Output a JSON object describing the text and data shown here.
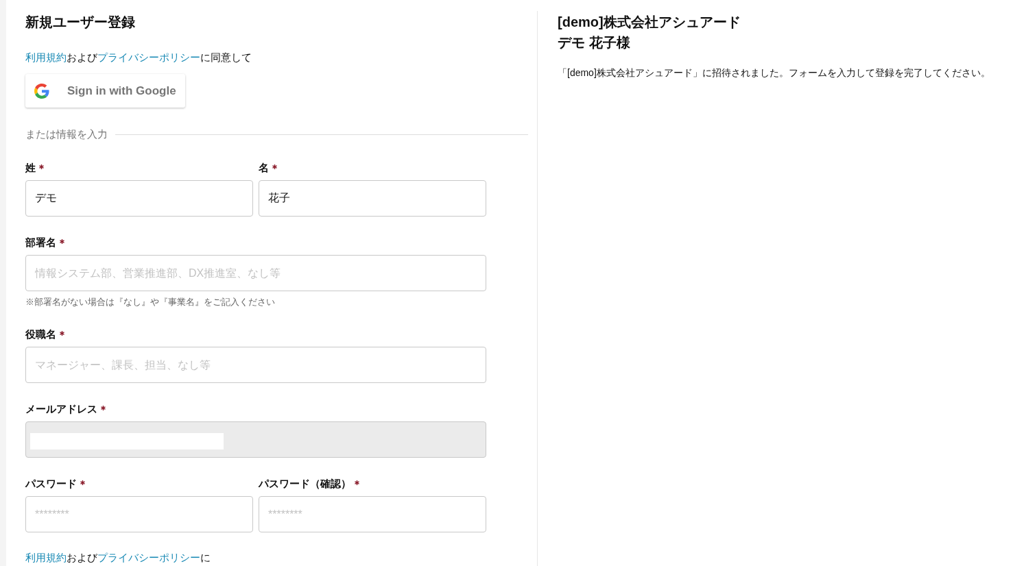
{
  "registration": {
    "title": "新規ユーザー登録",
    "consent": [
      {
        "kind": "link",
        "text": "利用規約"
      },
      {
        "kind": "text",
        "text": "および"
      },
      {
        "kind": "link",
        "text": "プライバシーポリシー"
      },
      {
        "kind": "text",
        "text": "に同意して"
      }
    ],
    "google_button": "Sign in with Google",
    "divider": "または情報を入力",
    "rows": [
      {
        "fields": [
          {
            "label": "姓",
            "required": true,
            "value": "デモ",
            "disabled": false,
            "redacted": false
          },
          {
            "label": "名",
            "required": true,
            "value": "花子",
            "disabled": false,
            "redacted": false
          }
        ]
      },
      {
        "fields": [
          {
            "label": "部署名",
            "required": true,
            "placeholder": "情報システム部、営業推進部、DX推進室、なし等",
            "hint": "※部署名がない場合は『なし』や『事業名』をご記入ください",
            "disabled": false,
            "redacted": false
          }
        ]
      },
      {
        "fields": [
          {
            "label": "役職名",
            "required": true,
            "placeholder": "マネージャー、課長、担当、なし等",
            "disabled": false,
            "redacted": false
          }
        ]
      },
      {
        "fields": [
          {
            "label": "メールアドレス",
            "required": true,
            "disabled": true,
            "redacted": true
          }
        ]
      },
      {
        "fields": [
          {
            "label": "パスワード",
            "required": true,
            "placeholder": "********",
            "disabled": false,
            "redacted": false
          },
          {
            "label": "パスワード（確認）",
            "required": true,
            "placeholder": "********",
            "disabled": false,
            "redacted": false
          }
        ]
      }
    ],
    "footer_consent": [
      {
        "kind": "link",
        "text": "利用規約"
      },
      {
        "kind": "text",
        "text": "および"
      },
      {
        "kind": "link",
        "text": "プライバシーポリシー"
      },
      {
        "kind": "text",
        "text": "に"
      }
    ]
  },
  "invitation": {
    "company": "[demo]株式会社アシュアード",
    "name": "デモ 花子様",
    "message": "「[demo]株式会社アシュアード」に招待されました。フォームを入力して登録を完了してください。"
  }
}
